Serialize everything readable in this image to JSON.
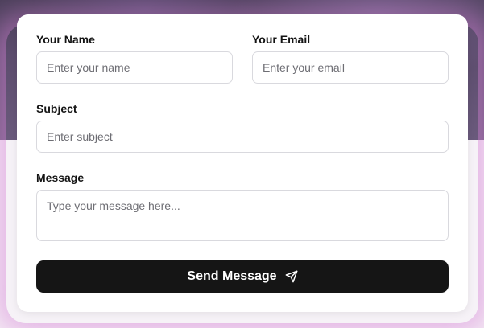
{
  "form": {
    "name": {
      "label": "Your Name",
      "placeholder": "Enter your name",
      "value": ""
    },
    "email": {
      "label": "Your Email",
      "placeholder": "Enter your email",
      "value": ""
    },
    "subject": {
      "label": "Subject",
      "placeholder": "Enter subject",
      "value": ""
    },
    "message": {
      "label": "Message",
      "placeholder": "Type your message here...",
      "value": ""
    },
    "submit": {
      "label": "Send Message",
      "icon": "send-icon"
    }
  },
  "colors": {
    "button_bg": "#151515",
    "glow": "#d682d6",
    "field_border": "#d9d9de"
  }
}
